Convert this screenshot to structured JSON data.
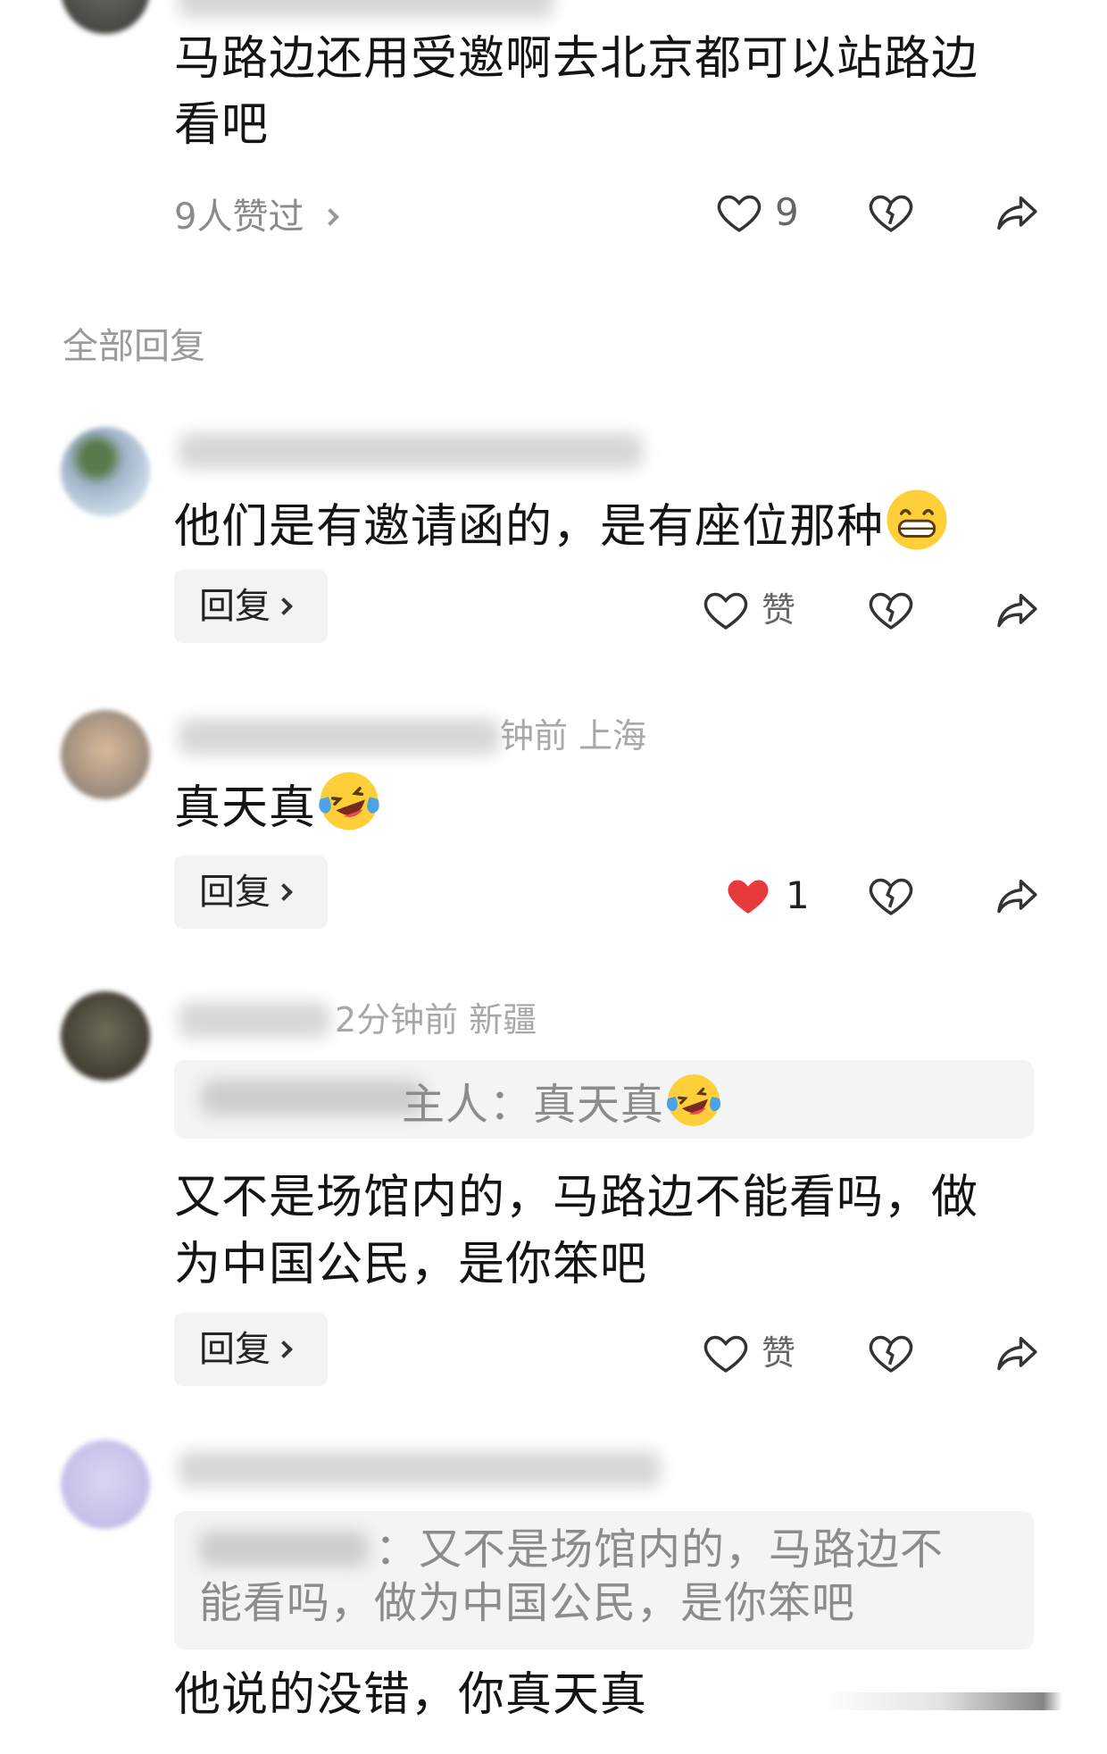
{
  "top_comment": {
    "text_line1": "马路边还用受邀啊去北京都可以站路边",
    "text_line2": "看吧",
    "likers_label": "9人赞过",
    "like_count": "9"
  },
  "section_label": "全部回复",
  "replies": [
    {
      "meta_visible": "",
      "text": "他们是有邀请函的，是有座位那种",
      "emoji": "grinning-face-emoji",
      "reply_label": "回复",
      "like_label": "赞",
      "liked": false
    },
    {
      "meta_visible": "钟前  上海",
      "text": "真天真",
      "emoji": "laughing-crying-emoji",
      "reply_label": "回复",
      "like_label": "1",
      "liked": true
    },
    {
      "meta_visible": "2分钟前  新疆",
      "quote": "主人：真天真",
      "quote_emoji": "laughing-crying-emoji",
      "text_line1": "又不是场馆内的，马路边不能看吗，做",
      "text_line2": "为中国公民，是你笨吧",
      "reply_label": "回复",
      "like_label": "赞",
      "liked": false
    },
    {
      "meta_visible": "",
      "quote_line1": "：又不是场馆内的，马路边不",
      "quote_line2": "能看吗，做为中国公民，是你笨吧",
      "text": "他说的没错，你真天真"
    }
  ],
  "colors": {
    "liked_heart": "#e8393c",
    "quote_bg": "#f4f4f4",
    "button_bg": "#f3f3f3",
    "muted_text": "#9a9a9a"
  }
}
